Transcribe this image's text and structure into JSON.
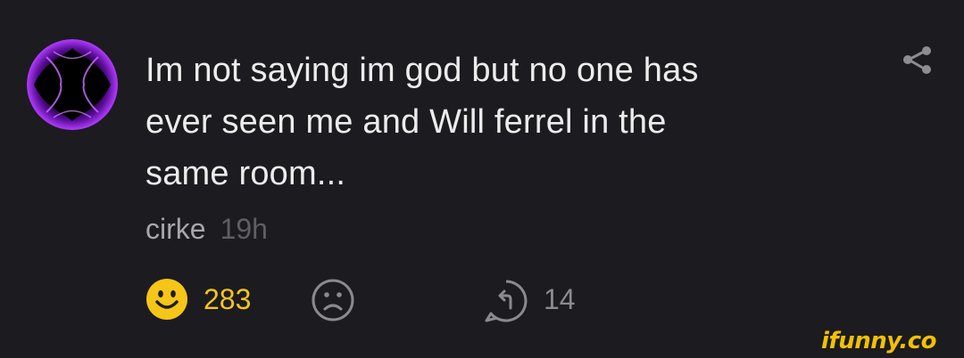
{
  "comment": {
    "lines": [
      "Im not saying im god but no one has",
      "ever seen me and Will ferrel in the",
      "same room..."
    ],
    "author": "cirke",
    "time": "19h"
  },
  "actions": {
    "smile_count": "283",
    "reply_count": "14"
  },
  "watermark": "ifunny.co",
  "icons": {
    "share": "share-icon",
    "smile": "smile-icon",
    "frown": "frown-icon",
    "reply": "reply-icon"
  },
  "colors": {
    "background": "#1c1b20",
    "text": "#ececec",
    "author": "#a7a7aa",
    "time": "#5e5e63",
    "smile": "#f5c518",
    "avatar_glow": "#a020f0",
    "watermark": "#f2c100"
  }
}
